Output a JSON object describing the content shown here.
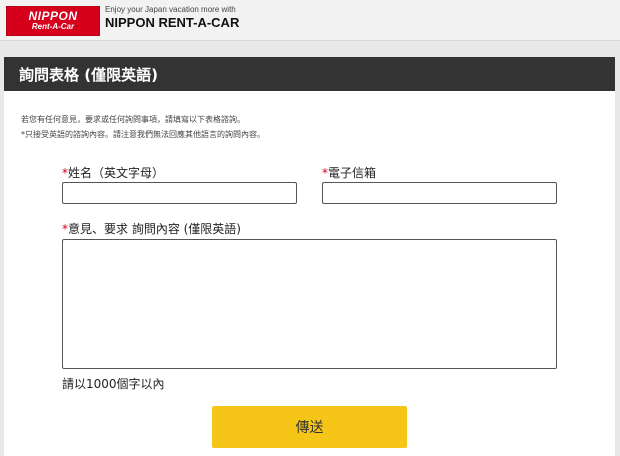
{
  "header": {
    "logo_main": "NIPPON",
    "logo_sub": "Rent-A-Car",
    "tagline": "Enjoy your Japan vacation more with",
    "brand": "NIPPON RENT-A-CAR"
  },
  "form": {
    "title": "詢問表格 (僅限英語)",
    "intro_lines": [
      "若您有任何意見，要求或任何詢問事項，請填寫以下表格諮詢。",
      "*只接受英語的諮詢內容。請注意我們無法回應其他語言的詢問內容。"
    ],
    "required_mark": "*",
    "name_label": "姓名（英文字母）",
    "name_value": "",
    "email_label": "電子信箱",
    "email_value": "",
    "message_label": "意見、要求 詢問內容 (僅限英語)",
    "message_value": "",
    "char_limit_hint": "請以1000個字以內",
    "submit_label": "傳送"
  },
  "colors": {
    "accent_red": "#d6001c",
    "header_dark": "#333333",
    "submit_yellow": "#f5c518"
  }
}
